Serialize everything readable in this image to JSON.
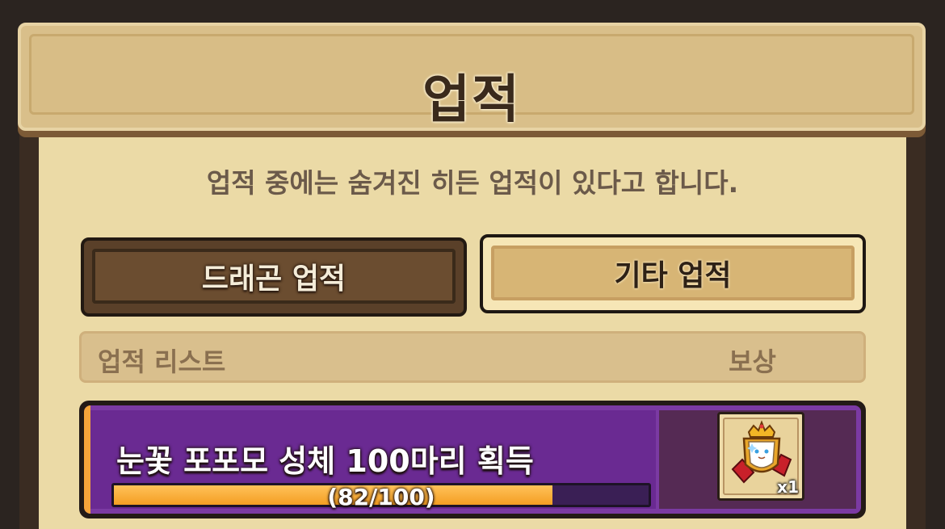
{
  "header": {
    "title": "업적"
  },
  "hint_text": "업적 중에는 숨겨진 히든 업적이 있다고 합니다.",
  "tabs": [
    {
      "label": "드래곤 업적",
      "selected": false
    },
    {
      "label": "기타 업적",
      "selected": true
    }
  ],
  "list_header": {
    "left_label": "업적 리스트",
    "right_label": "보상"
  },
  "achievements": [
    {
      "title": "눈꽃 포포모 성체 100마리 획득",
      "progress_current": 82,
      "progress_total": 100,
      "progress_text": "(82/100)",
      "progress_fraction": 0.82,
      "reward": {
        "icon": "gem-crown-emblem-icon",
        "quantity": "x1"
      }
    }
  ],
  "colors": {
    "background": "#2b2420",
    "panel": "#ebdaa6",
    "banner": "#d9bf8a",
    "achievement_purple": "#7b3aa3",
    "progress_orange": "#f49e22"
  }
}
